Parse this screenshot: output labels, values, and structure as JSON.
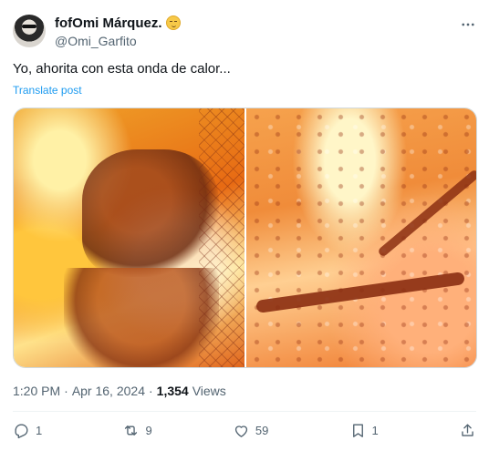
{
  "user": {
    "display_name": "fofOmi Márquez.",
    "display_emoji_icon": "relieved-face-icon",
    "handle": "@Omi_Garfito",
    "avatar_icon": "user-avatar"
  },
  "tweet": {
    "text": "Yo, ahorita con esta onda de calor...",
    "translate_label": "Translate post"
  },
  "media": {
    "image_count": 2,
    "images": [
      {
        "name": "media-image-left"
      },
      {
        "name": "media-image-right"
      }
    ]
  },
  "meta": {
    "time": "1:20 PM",
    "separator": "·",
    "date": "Apr 16, 2024",
    "separator2": "·",
    "views_count": "1,354",
    "views_label": "Views"
  },
  "actions": {
    "reply": {
      "icon": "reply-icon",
      "count": "1"
    },
    "repost": {
      "icon": "repost-icon",
      "count": "9"
    },
    "like": {
      "icon": "heart-icon",
      "count": "59"
    },
    "bookmark": {
      "icon": "bookmark-icon",
      "count": "1"
    },
    "share": {
      "icon": "share-icon"
    }
  },
  "colors": {
    "link": "#1d9bf0",
    "secondary_text": "#536471",
    "primary_text": "#0f1419",
    "divider": "#eff3f4"
  }
}
